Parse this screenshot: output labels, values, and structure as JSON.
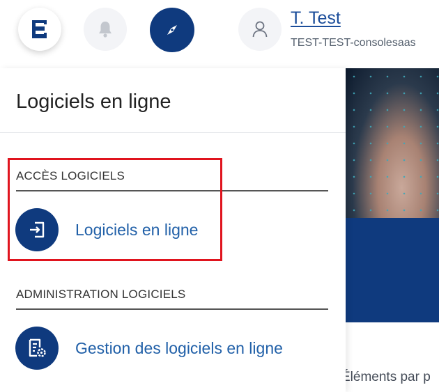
{
  "header": {
    "menu_icon": "menu-list-icon",
    "notifications_icon": "bell-icon",
    "navigation_icon": "compass-icon",
    "user_icon": "user-icon",
    "user_name": "T. Test",
    "user_org": "TEST-TEST-consolesaas",
    "accent_color": "#0f3a7e"
  },
  "panel": {
    "title": "Logiciels en ligne",
    "sections": [
      {
        "label": "ACCÈS LOGICIELS",
        "items": [
          {
            "label": "Logiciels en ligne",
            "icon": "login-icon"
          }
        ]
      },
      {
        "label": "ADMINISTRATION LOGICIELS",
        "items": [
          {
            "label": "Gestion des logiciels en ligne",
            "icon": "document-settings-icon"
          }
        ]
      }
    ]
  },
  "background": {
    "footer_text": "Éléments par p"
  },
  "annotation": {
    "highlight_color": "#e0141e"
  }
}
